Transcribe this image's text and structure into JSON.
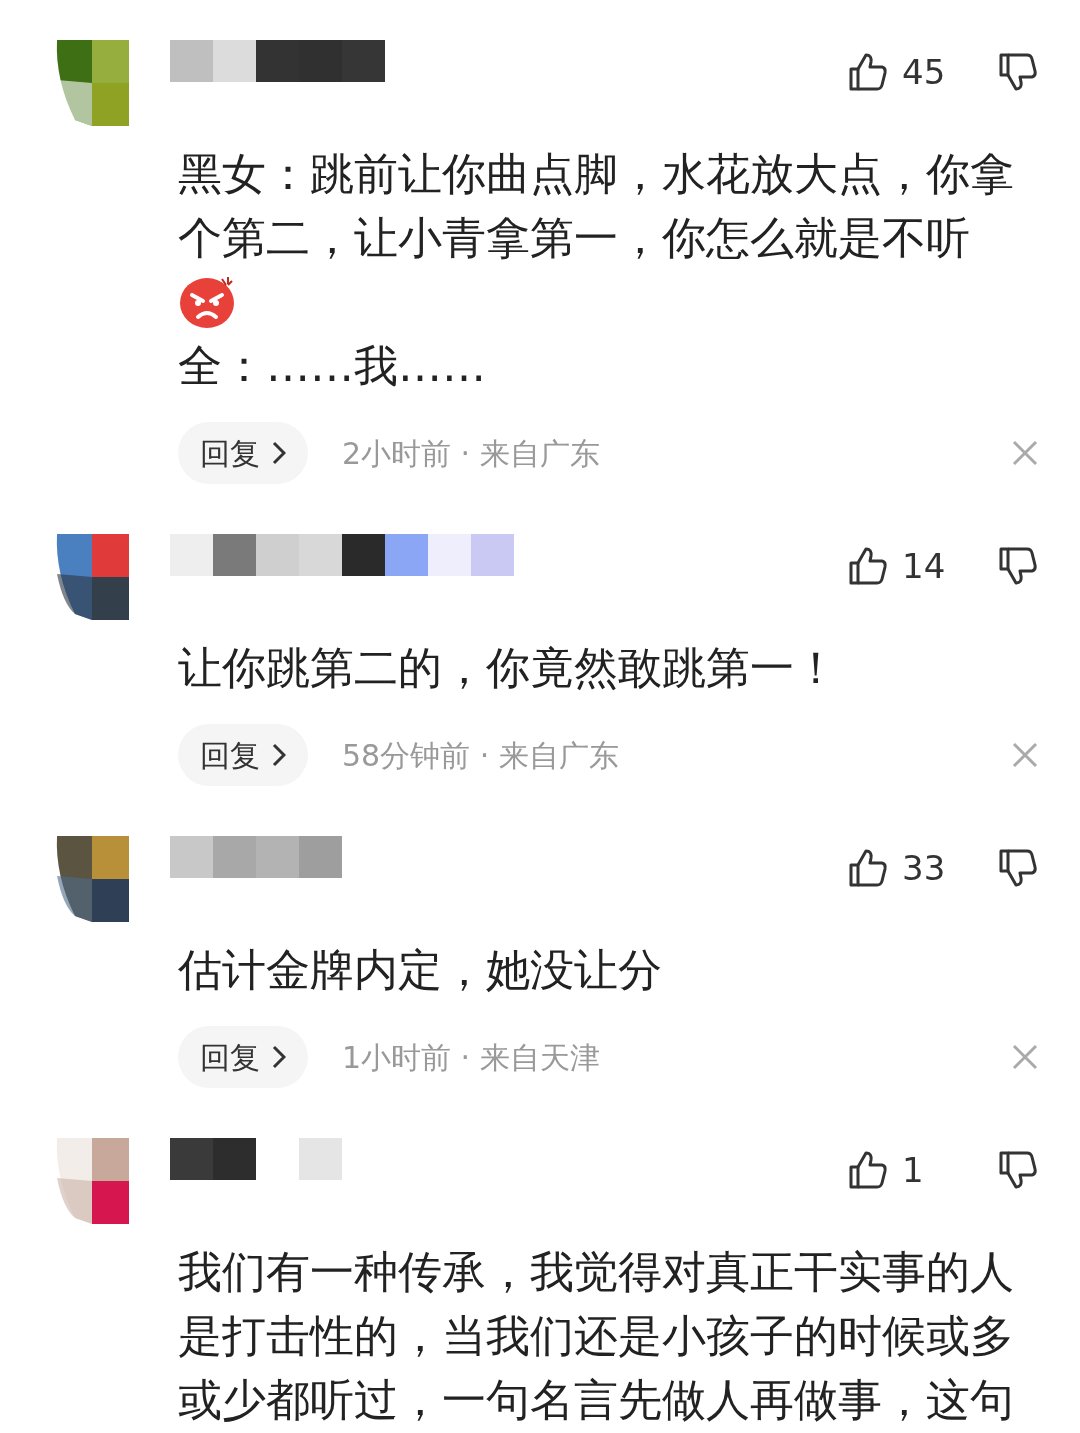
{
  "comments": [
    {
      "likes": "45",
      "content": [
        {
          "kind": "text",
          "text": "黑女：跳前让你曲点脚，水花放大点，你拿个第二，让小青拿第一，你怎么就是不听"
        },
        {
          "kind": "emoji"
        },
        {
          "kind": "text",
          "text": "全：……我……"
        }
      ],
      "reply": "回复",
      "meta": "2小时前 · 来自广东"
    },
    {
      "likes": "14",
      "content": [
        {
          "kind": "text",
          "text": "让你跳第二的，你竟然敢跳第一！"
        }
      ],
      "reply": "回复",
      "meta": "58分钟前 · 来自广东"
    },
    {
      "likes": "33",
      "content": [
        {
          "kind": "text",
          "text": "估计金牌内定，她没让分"
        }
      ],
      "reply": "回复",
      "meta": "1小时前 · 来自天津"
    },
    {
      "likes": "1",
      "content": [
        {
          "kind": "text",
          "text": "我们有一种传承，我觉得对真正干实事的人是打击性的，当我们还是小孩子的时候或多或少都听过，一句名言先做人再做事，这句"
        }
      ]
    }
  ]
}
